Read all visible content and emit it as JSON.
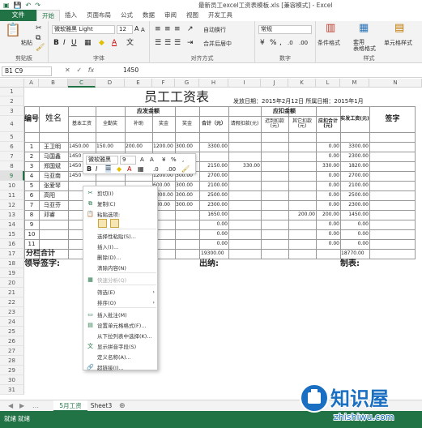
{
  "window": {
    "title": "最新员工excel工资表模板.xls [兼容模式] - Excel"
  },
  "ribbon_tabs": [
    "文件",
    "开始",
    "插入",
    "页面布局",
    "公式",
    "数据",
    "审阅",
    "视图",
    "开发工具"
  ],
  "ribbon": {
    "font_name": "微软雅黑 Light",
    "font_size": "12",
    "wrap_text": "自动换行",
    "merge_center": "合并后居中",
    "number_format": "常规",
    "cond_format": "条件格式",
    "table_format": "套用\n表格格式",
    "cell_style": "单元格样式",
    "paste": "粘贴",
    "groups": [
      "剪贴板",
      "字体",
      "对齐方式",
      "数字",
      "样式"
    ]
  },
  "formula_bar": {
    "name_box": "B1 C9",
    "value": "1450"
  },
  "columns": [
    "A",
    "B",
    "C",
    "D",
    "E",
    "F",
    "G",
    "H",
    "I",
    "J",
    "K",
    "L",
    "M",
    "N"
  ],
  "rows": [
    "1",
    "2",
    "3",
    "4",
    "5",
    "6",
    "7",
    "8",
    "9",
    "10",
    "11",
    "12",
    "13",
    "14",
    "15",
    "16",
    "17",
    "18",
    "19",
    "20",
    "21",
    "22",
    "23",
    "24",
    "25",
    "26",
    "27",
    "28",
    "29",
    "30",
    "31"
  ],
  "sheet": {
    "title": "员工工资表",
    "issue_date": "发放日期：2015年2月12日  所属日期：2015年1月",
    "col_id": "编号",
    "col_name": "姓名",
    "col_pay_total_group": "应发金额",
    "col_base": "基本工资",
    "col_attend": "全勤奖",
    "col_subsidy": "补助",
    "col_overtime": "奖金",
    "col_bonus": "奖金",
    "col_sum1": "合计（元）",
    "col_deduct_group": "应扣金额",
    "col_leave": "请假扣款(元)",
    "col_late": "迟到扣款(元)",
    "col_other": "其它扣款(元)",
    "col_deduct_sum": "应扣合计(元)",
    "col_actual": "实发工资(元)",
    "col_sign": "签字",
    "rows": [
      {
        "id": "1",
        "name": "王卫明",
        "base": "1450.00",
        "attend": "150.00",
        "subsidy": "200.00",
        "ot": "1200.00",
        "bonus": "300.00",
        "sum": "3300.00",
        "leave": "",
        "late": "",
        "other": "",
        "dsum": "0.00",
        "actual": "3300.00"
      },
      {
        "id": "2",
        "name": "马国鑫",
        "base": "1450",
        "attend": "",
        "subsidy": "",
        "ot": "",
        "bonus": "",
        "sum": "",
        "leave": "",
        "late": "",
        "other": "",
        "dsum": "0.00",
        "actual": "2300.00"
      },
      {
        "id": "3",
        "name": "郑国斌",
        "base": "1450",
        "attend": "",
        "subsidy": "",
        "ot": "",
        "bonus": "",
        "sum": "2150.00",
        "leave": "330.00",
        "late": "",
        "other": "",
        "dsum": "330.00",
        "actual": "1820.00"
      },
      {
        "id": "4",
        "name": "马亚南",
        "base": "1450",
        "attend": "",
        "subsidy": "",
        "ot": "1200.00",
        "bonus": "300.00",
        "sum": "2700.00",
        "leave": "",
        "late": "",
        "other": "",
        "dsum": "0.00",
        "actual": "2700.00"
      },
      {
        "id": "5",
        "name": "张爱琴",
        "base": "",
        "attend": "",
        "subsidy": "",
        "ot": "600.00",
        "bonus": "300.00",
        "sum": "2100.00",
        "leave": "",
        "late": "",
        "other": "",
        "dsum": "0.00",
        "actual": "2100.00"
      },
      {
        "id": "6",
        "name": "高阳",
        "base": "",
        "attend": "",
        "subsidy": "",
        "ot": "1000.00",
        "bonus": "300.00",
        "sum": "2500.00",
        "leave": "",
        "late": "",
        "other": "",
        "dsum": "0.00",
        "actual": "2500.00"
      },
      {
        "id": "7",
        "name": "马亚芬",
        "base": "",
        "attend": "",
        "subsidy": "",
        "ot": "800.00",
        "bonus": "300.00",
        "sum": "2300.00",
        "leave": "",
        "late": "",
        "other": "",
        "dsum": "0.00",
        "actual": "2300.00"
      },
      {
        "id": "8",
        "name": "邓睿",
        "base": "",
        "attend": "",
        "subsidy": "",
        "ot": "",
        "bonus": "",
        "sum": "1650.00",
        "leave": "",
        "late": "",
        "other": "200.00",
        "dsum": "200.00",
        "actual": "1450.00"
      },
      {
        "id": "9",
        "name": "",
        "base": "",
        "attend": "",
        "subsidy": "",
        "ot": "",
        "bonus": "",
        "sum": "0.00",
        "leave": "",
        "late": "",
        "other": "",
        "dsum": "0.00",
        "actual": "0.00"
      },
      {
        "id": "10",
        "name": "",
        "base": "",
        "attend": "",
        "subsidy": "",
        "ot": "",
        "bonus": "",
        "sum": "0.00",
        "leave": "",
        "late": "",
        "other": "",
        "dsum": "0.00",
        "actual": "0.00"
      },
      {
        "id": "11",
        "name": "",
        "base": "",
        "attend": "",
        "subsidy": "",
        "ot": "",
        "bonus": "",
        "sum": "0.00",
        "leave": "",
        "late": "",
        "other": "",
        "dsum": "0.00",
        "actual": "0.00"
      }
    ],
    "total_label": "分栏合计",
    "total_sum": "19300.00",
    "total_actual": "18770.00",
    "sign_leader": "领导签字:",
    "sign_cashier": "出纳:",
    "sign_maker": "制表:"
  },
  "mini_toolbar": {
    "font": "微软雅黑",
    "size": "9"
  },
  "context_menu": [
    {
      "label": "剪切(I)",
      "icon": "cut-icon",
      "glyph": "✂"
    },
    {
      "label": "复制(C)",
      "icon": "copy-icon",
      "glyph": "⧉"
    },
    {
      "label": "粘贴选项:",
      "icon": "paste-icon",
      "glyph": "📋"
    },
    {
      "label": "",
      "icon": "",
      "glyph": ""
    },
    {
      "label": "选择性粘贴(S)...",
      "icon": "",
      "glyph": ""
    },
    {
      "label": "插入(I)...",
      "icon": "",
      "glyph": ""
    },
    {
      "label": "删除(D)...",
      "icon": "",
      "glyph": ""
    },
    {
      "label": "清除内容(N)",
      "icon": "",
      "glyph": ""
    },
    {
      "label": "快速分析(Q)",
      "icon": "quick-analysis-icon",
      "glyph": "▦"
    },
    {
      "label": "筛选(E)",
      "icon": "",
      "glyph": ""
    },
    {
      "label": "排序(O)",
      "icon": "",
      "glyph": ""
    },
    {
      "label": "插入批注(M)",
      "icon": "comment-icon",
      "glyph": "▭"
    },
    {
      "label": "设置单元格格式(F)...",
      "icon": "format-cells-icon",
      "glyph": "▤"
    },
    {
      "label": "从下拉列表中选择(K)...",
      "icon": "",
      "glyph": ""
    },
    {
      "label": "显示拼音字段(S)",
      "icon": "pinyin-icon",
      "glyph": "文"
    },
    {
      "label": "定义名称(A)...",
      "icon": "",
      "glyph": ""
    },
    {
      "label": "超链接(I)...",
      "icon": "hyperlink-icon",
      "glyph": "🔗"
    }
  ],
  "sheet_tabs": [
    "5月工资",
    "Sheet3"
  ],
  "status": {
    "left": "就绪",
    "mode": "就绪"
  },
  "watermark": {
    "brand": "知识屋",
    "url": "zhishiwu.com"
  },
  "colors": {
    "excel_green": "#217346",
    "watermark_blue": "#1a6fc2"
  }
}
